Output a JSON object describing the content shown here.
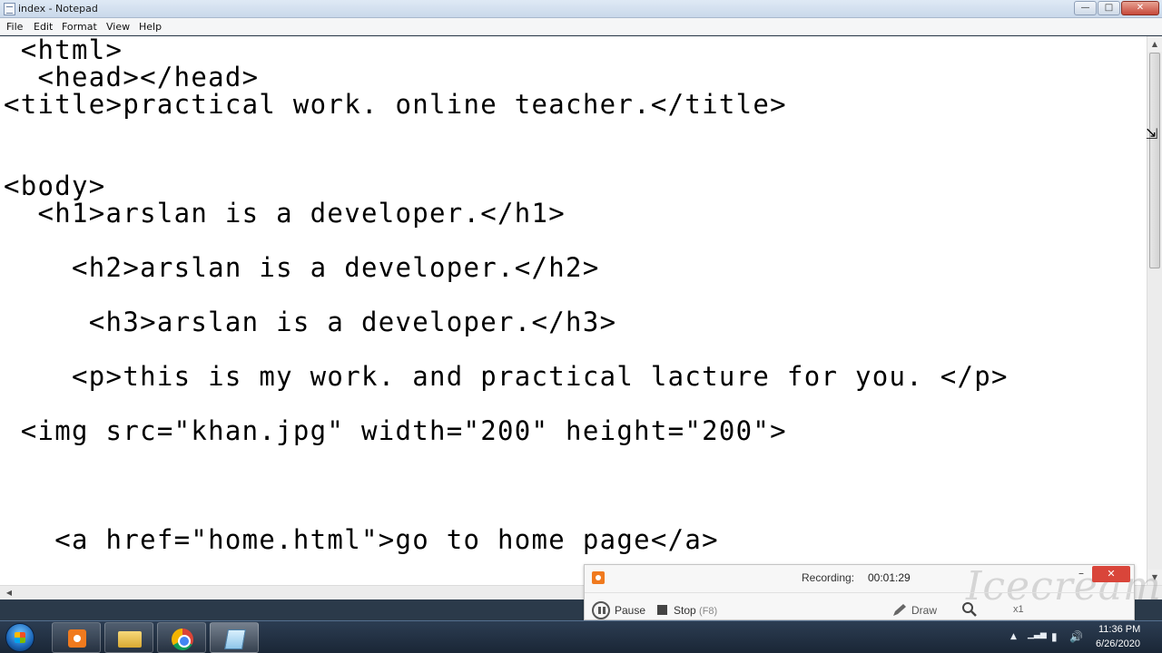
{
  "window": {
    "title": "index - Notepad",
    "minimize_glyph": "—",
    "maximize_glyph": "□",
    "close_glyph": "✕"
  },
  "menubar": {
    "items": [
      "File",
      "Edit",
      "Format",
      "View",
      "Help"
    ]
  },
  "editor": {
    "lines": [
      " <html>",
      "  <head></head>",
      "<title>practical work. online teacher.</title>",
      "",
      "",
      "<body>",
      "  <h1>arslan is a developer.</h1>",
      "",
      "    <h2>arslan is a developer.</h2>",
      "",
      "     <h3>arslan is a developer.</h3>",
      "",
      "    <p>this is my work. and practical lacture for you. </p>",
      "",
      " <img src=\"khan.jpg\" width=\"200\" height=\"200\">",
      "",
      "",
      "",
      "   <a href=\"home.html\">go to home page</a>"
    ]
  },
  "recorder": {
    "status_label": "Recording:",
    "elapsed": "00:01:29",
    "pause_label": "Pause",
    "stop_label": "Stop",
    "stop_shortcut": "(F8)",
    "draw_label": "Draw",
    "zoom_label": "x1",
    "minimize_glyph": "–",
    "close_glyph": "✕",
    "watermark": "Icecream",
    "accent_color": "#f07a1e"
  },
  "taskbar": {
    "apps": [
      "recorder-icon",
      "folder-icon",
      "chrome-icon",
      "notepad-icon"
    ],
    "tray_glyphs": [
      "▲",
      "▁▃▅",
      "▮",
      "🔊"
    ],
    "clock": {
      "time": "11:36 PM",
      "date": "6/26/2020"
    }
  }
}
